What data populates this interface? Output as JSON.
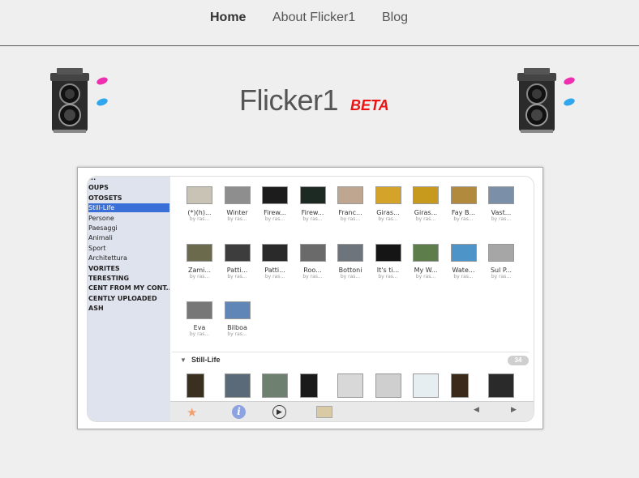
{
  "nav": {
    "home": "Home",
    "about": "About Flicker1",
    "blog": "Blog"
  },
  "header": {
    "title": "Flicker1",
    "badge": "BETA"
  },
  "screenshot": {
    "sidebar": [
      {
        "label": "...",
        "header": true
      },
      {
        "label": "OUPS",
        "header": true
      },
      {
        "label": "OTOSETS",
        "header": true
      },
      {
        "label": "Still-Life",
        "selected": true
      },
      {
        "label": "Persone"
      },
      {
        "label": "Paesaggi"
      },
      {
        "label": "Animali"
      },
      {
        "label": "Sport"
      },
      {
        "label": "Architettura"
      },
      {
        "label": "VORITES",
        "header": true
      },
      {
        "label": "TERESTING",
        "header": true
      },
      {
        "label": "CENT FROM MY CONT...",
        "header": true
      },
      {
        "label": "CENTLY UPLOADED",
        "header": true
      },
      {
        "label": "ASH",
        "header": true
      }
    ],
    "grid_photos": [
      {
        "title": "(*)(h)...",
        "by": "by ras...",
        "color": "#c9c3b5"
      },
      {
        "title": "Winter",
        "by": "by ras...",
        "color": "#8e8e8e"
      },
      {
        "title": "Firew...",
        "by": "by ras...",
        "color": "#1c1c1c"
      },
      {
        "title": "Firew...",
        "by": "by ras...",
        "color": "#1d2a24"
      },
      {
        "title": "Franc...",
        "by": "by ras...",
        "color": "#bfa690"
      },
      {
        "title": "Giras...",
        "by": "by ras...",
        "color": "#d4a32a"
      },
      {
        "title": "Giras...",
        "by": "by ras...",
        "color": "#c79a1e"
      },
      {
        "title": "Fay B...",
        "by": "by ras...",
        "color": "#b28a3e"
      },
      {
        "title": "Vast...",
        "by": "by ras...",
        "color": "#7b8fa8"
      },
      {
        "title": "Zami...",
        "by": "by ras...",
        "color": "#6c6a4c"
      },
      {
        "title": "Patti...",
        "by": "by ras...",
        "color": "#3d3d3d"
      },
      {
        "title": "Patti...",
        "by": "by ras...",
        "color": "#2a2a2a"
      },
      {
        "title": "Roo...",
        "by": "by ras...",
        "color": "#6a6a6a"
      },
      {
        "title": "Bottoni",
        "by": "by ras...",
        "color": "#6d747c"
      },
      {
        "title": "It's ti...",
        "by": "by ras...",
        "color": "#151515"
      },
      {
        "title": "My W...",
        "by": "by ras...",
        "color": "#5d7d4a"
      },
      {
        "title": "Wate...",
        "by": "by ras...",
        "color": "#4d94c9"
      },
      {
        "title": "Sul P...",
        "by": "by ras...",
        "color": "#a6a6a6"
      },
      {
        "title": "Eva",
        "by": "by ras...",
        "color": "#777777"
      },
      {
        "title": "Bilboa",
        "by": "by ras...",
        "color": "#5f86b6"
      }
    ],
    "section_title": "Still-Life",
    "section_count": "34",
    "section_photos": [
      {
        "color": "#3a3020"
      },
      {
        "color": "#5a6a78"
      },
      {
        "color": "#6e8070"
      },
      {
        "color": "#1a1a1a"
      },
      {
        "color": "#d8d8d8"
      },
      {
        "color": "#cfcfcf"
      },
      {
        "color": "#e6eef2"
      },
      {
        "color": "#3b2a1a"
      },
      {
        "color": "#2a2a2a"
      }
    ],
    "accent": "#3a6fd8"
  }
}
